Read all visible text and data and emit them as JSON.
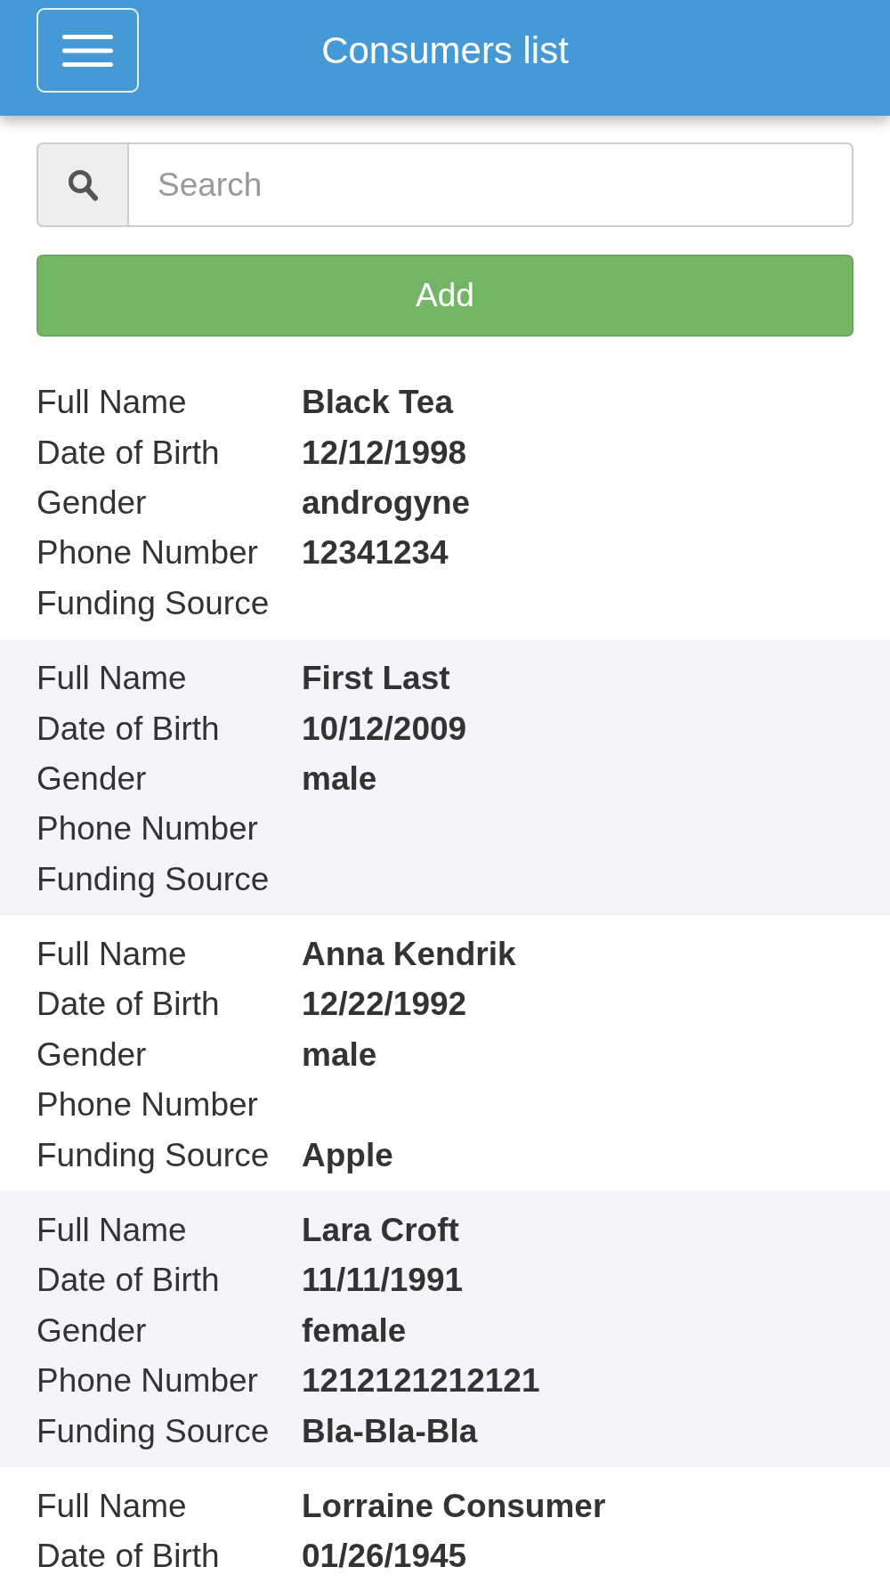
{
  "header": {
    "title": "Consumers list"
  },
  "search": {
    "placeholder": "Search"
  },
  "add_button": {
    "label": "Add"
  },
  "consumers": [
    {
      "fields": [
        {
          "label": "Full Name",
          "value": "Black Tea"
        },
        {
          "label": "Date of Birth",
          "value": "12/12/1998"
        },
        {
          "label": "Gender",
          "value": "androgyne"
        },
        {
          "label": "Phone Number",
          "value": "12341234"
        },
        {
          "label": "Funding Source"
        }
      ]
    },
    {
      "fields": [
        {
          "label": "Full Name",
          "value": "First Last"
        },
        {
          "label": "Date of Birth",
          "value": "10/12/2009"
        },
        {
          "label": "Gender",
          "value": "male"
        },
        {
          "label": "Phone Number"
        },
        {
          "label": "Funding Source"
        }
      ]
    },
    {
      "fields": [
        {
          "label": "Full Name",
          "value": "Anna Kendrik"
        },
        {
          "label": "Date of Birth",
          "value": "12/22/1992"
        },
        {
          "label": "Gender",
          "value": "male"
        },
        {
          "label": "Phone Number"
        },
        {
          "label": "Funding Source",
          "value": "Apple"
        }
      ]
    },
    {
      "fields": [
        {
          "label": "Full Name",
          "value": "Lara Croft"
        },
        {
          "label": "Date of Birth",
          "value": "11/11/1991"
        },
        {
          "label": "Gender",
          "value": "female"
        },
        {
          "label": "Phone Number",
          "value": "1212121212121"
        },
        {
          "label": "Funding Source",
          "value": "Bla-Bla-Bla"
        }
      ]
    },
    {
      "fields": [
        {
          "label": "Full Name",
          "value": "Lorraine Consumer"
        },
        {
          "label": "Date of Birth",
          "value": "01/26/1945"
        }
      ]
    }
  ]
}
